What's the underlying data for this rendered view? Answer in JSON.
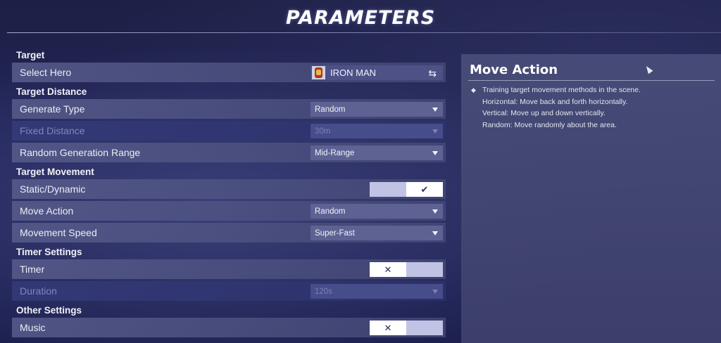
{
  "page": {
    "title": "PARAMETERS"
  },
  "sections": {
    "target": {
      "header": "Target",
      "select_hero": {
        "label": "Select Hero",
        "value": "IRON MAN",
        "icon": "swap-icon"
      }
    },
    "target_distance": {
      "header": "Target Distance",
      "generate_type": {
        "label": "Generate Type",
        "value": "Random"
      },
      "fixed_distance": {
        "label": "Fixed Distance",
        "value": "30m"
      },
      "random_range": {
        "label": "Random Generation Range",
        "value": "Mid-Range"
      }
    },
    "target_movement": {
      "header": "Target Movement",
      "static_dynamic": {
        "label": "Static/Dynamic",
        "state": "on",
        "symbol": "✔"
      },
      "move_action": {
        "label": "Move Action",
        "value": "Random"
      },
      "movement_speed": {
        "label": "Movement Speed",
        "value": "Super-Fast"
      }
    },
    "timer_settings": {
      "header": "Timer Settings",
      "timer": {
        "label": "Timer",
        "state": "off",
        "symbol": "✕"
      },
      "duration": {
        "label": "Duration",
        "value": "120s"
      }
    },
    "other_settings": {
      "header": "Other Settings",
      "music": {
        "label": "Music",
        "state": "off",
        "symbol": "✕"
      }
    }
  },
  "info_panel": {
    "title": "Move Action",
    "bullet": "◆",
    "lines": [
      "Training target movement methods in the scene.",
      "Horizontal: Move back and forth horizontally.",
      "Vertical: Move up and down vertically.",
      "Random: Move randomly about the area."
    ]
  },
  "colors": {
    "background": "#1f2250",
    "row": "#585c8c",
    "row_disabled": "#343a78",
    "dropdown": "#5e6293",
    "toggle_on": "#ffffff",
    "toggle_track": "#c0c3e4"
  }
}
